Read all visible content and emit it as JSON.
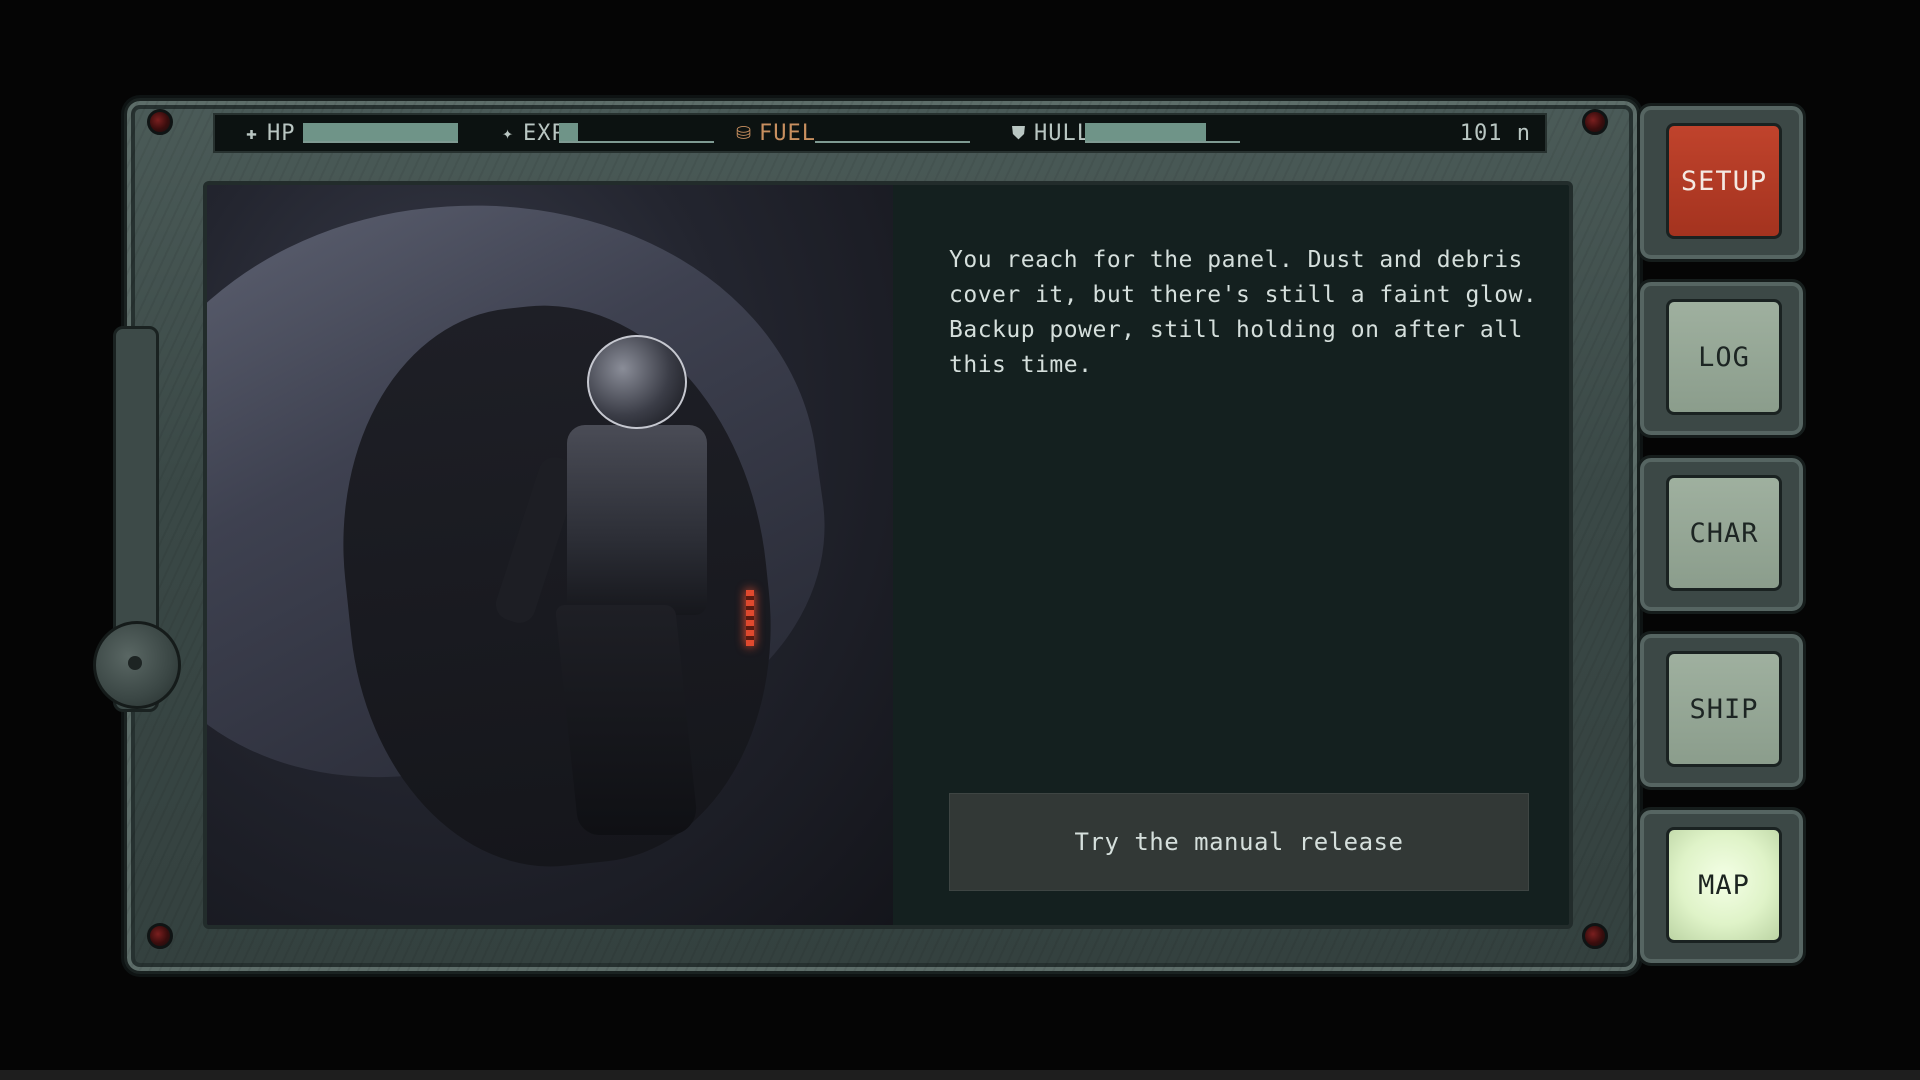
{
  "hud": {
    "hp": {
      "label": "HP",
      "level": 1.0
    },
    "exp": {
      "label": "EXP",
      "level": 0.12
    },
    "fuel": {
      "label": "FUEL",
      "level": 0.0
    },
    "hull": {
      "label": "HULL",
      "level": 0.78
    },
    "distance": "101 n"
  },
  "story": {
    "text": "You reach for the panel. Dust and debris cover it, but there's still a faint glow. Backup power, still holding on after all this time."
  },
  "choices": [
    {
      "label": "Try the manual release"
    }
  ],
  "menu": {
    "setup": "SETUP",
    "log": "LOG",
    "char": "CHAR",
    "ship": "SHIP",
    "map": "MAP"
  },
  "icons": {
    "hp": "plus-icon",
    "exp": "sparkle-icon",
    "fuel": "fuel-drop-icon",
    "hull": "shield-icon"
  },
  "colors": {
    "bar": "#6f9488",
    "fuel_label": "#c88f5f",
    "setup": "#b23a24",
    "map_glow": "#eaf8d6"
  }
}
